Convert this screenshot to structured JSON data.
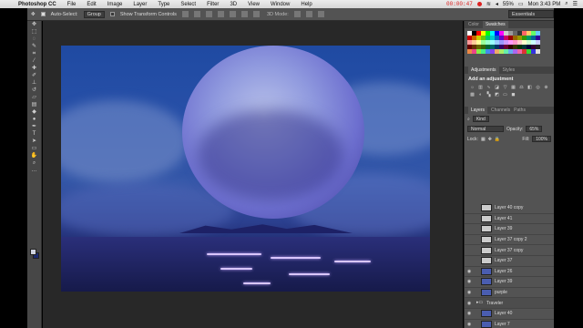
{
  "menubar": {
    "app": "Photoshop CC",
    "items": [
      "File",
      "Edit",
      "Image",
      "Layer",
      "Type",
      "Select",
      "Filter",
      "3D",
      "View",
      "Window",
      "Help"
    ],
    "record_time": "00:00:47",
    "battery": "55%",
    "clock": "Mon 3:43 PM"
  },
  "options_bar": {
    "auto_select_label": "Auto-Select:",
    "auto_select_value": "Group",
    "transform_label": "Show Transform Controls",
    "mode_label": "3D Mode:",
    "workspace": "Essentials"
  },
  "swatches_panel": {
    "tabs": [
      "Color",
      "Swatches"
    ],
    "active_tab": "Swatches"
  },
  "adjustments_panel": {
    "tabs": [
      "Adjustments",
      "Styles"
    ],
    "active_tab": "Adjustments",
    "title": "Add an adjustment"
  },
  "layers_panel": {
    "tabs": [
      "Layers",
      "Channels",
      "Paths"
    ],
    "active_tab": "Layers",
    "filter": "Kind",
    "blend_mode": "Normal",
    "opacity_label": "Opacity:",
    "opacity": "65%",
    "lock_label": "Lock:",
    "fill_label": "Fill:",
    "fill": "100%",
    "layers": [
      {
        "name": "Layer 40 copy",
        "visible": false,
        "type": "layer"
      },
      {
        "name": "Layer 41",
        "visible": false,
        "type": "layer"
      },
      {
        "name": "Layer 39",
        "visible": false,
        "type": "layer"
      },
      {
        "name": "Layer 37 copy 2",
        "visible": false,
        "type": "layer"
      },
      {
        "name": "Layer 37 copy",
        "visible": false,
        "type": "layer"
      },
      {
        "name": "Layer 37",
        "visible": false,
        "type": "layer"
      },
      {
        "name": "Layer 26",
        "visible": true,
        "type": "layer"
      },
      {
        "name": "Layer 39",
        "visible": true,
        "type": "layer"
      },
      {
        "name": "purple",
        "visible": true,
        "type": "layer"
      },
      {
        "name": "Traveler",
        "visible": true,
        "type": "group"
      },
      {
        "name": "Layer 40",
        "visible": true,
        "type": "layer"
      },
      {
        "name": "Layer 7",
        "visible": true,
        "type": "layer"
      }
    ]
  },
  "colors": {
    "foreground": "#cfd3df",
    "background": "#1b2a70"
  }
}
